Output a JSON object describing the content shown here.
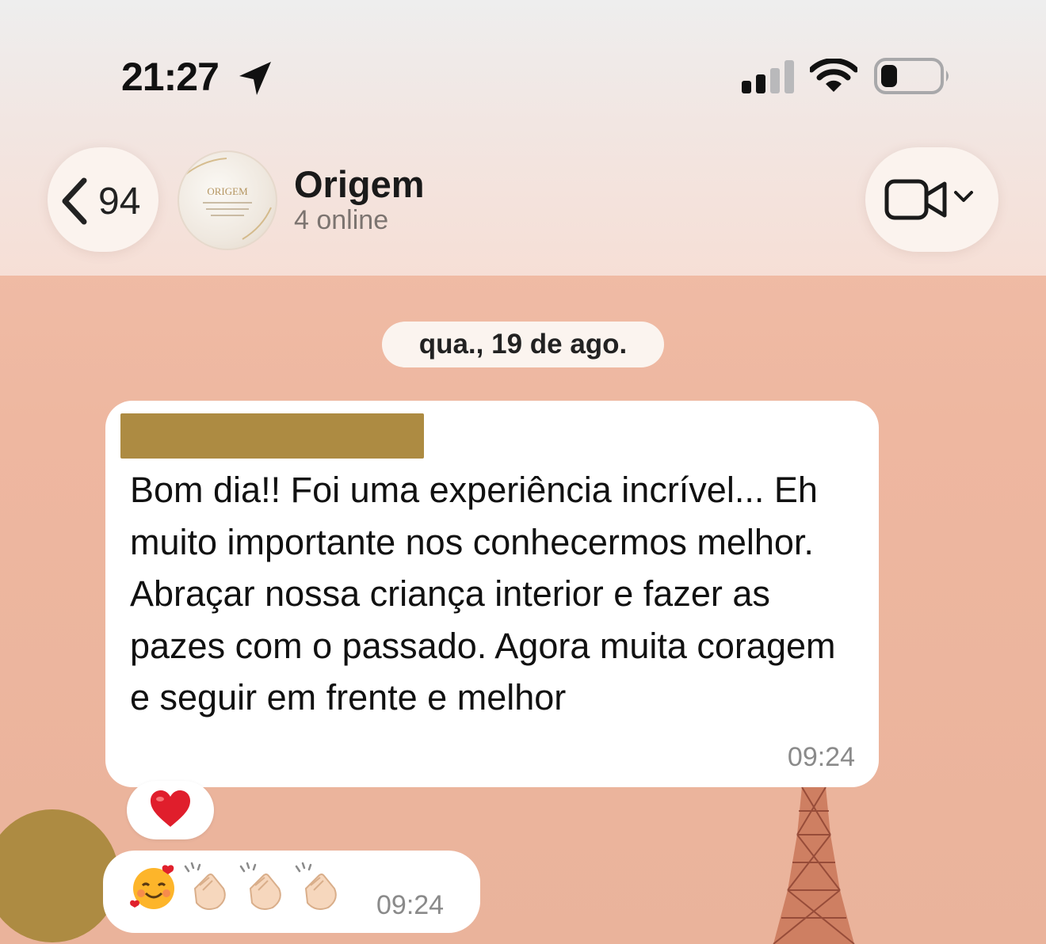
{
  "status_bar": {
    "time": "21:27",
    "icons": [
      "location-arrow-icon",
      "cellular-signal-icon",
      "wifi-icon",
      "battery-icon"
    ],
    "battery_level": 0.2
  },
  "header": {
    "back_count": "94",
    "title": "Origem",
    "subtitle": "4 online",
    "avatar_text": "ORIGEM",
    "icons": [
      "chevron-left-icon",
      "video-camera-icon",
      "chevron-down-icon"
    ]
  },
  "chat": {
    "date_chip": "qua., 19 de ago.",
    "messages": [
      {
        "text": "Bom dia!! Foi uma experiência incrível... Eh muito importante nos conhecermos melhor. Abraçar nossa criança interior e fazer as pazes com o passado. Agora muita coragem e seguir em frente e melhor",
        "time": "09:24",
        "reaction": "❤️"
      },
      {
        "emojis": [
          "🥰",
          "👏🏻",
          "👏🏻",
          "👏🏻"
        ],
        "time": "09:24"
      }
    ]
  },
  "colors": {
    "redaction": "#ad8b42",
    "chat_background": "#efb9a2",
    "bubble": "#ffffff",
    "header_pill": "#fbf3ee"
  }
}
